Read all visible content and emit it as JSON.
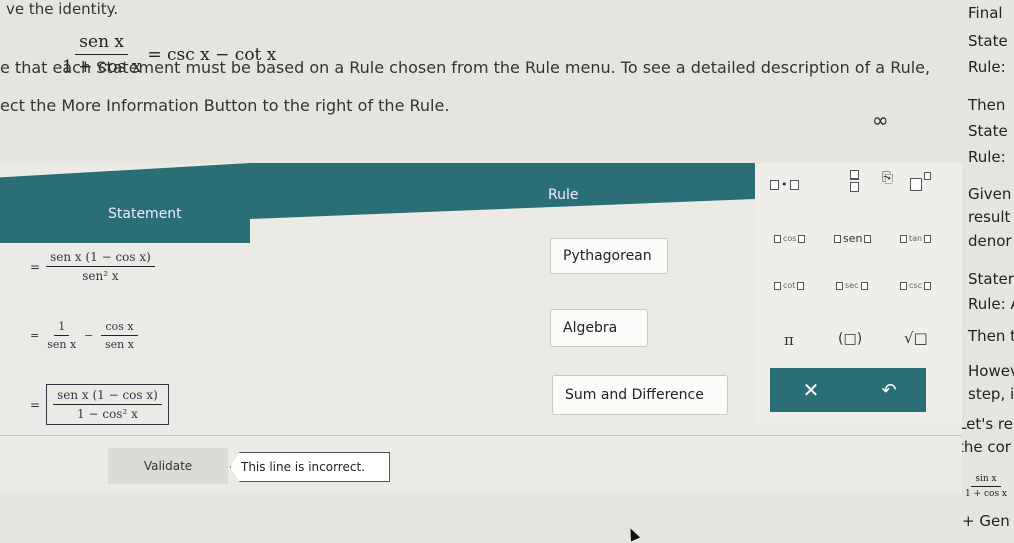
{
  "page": {
    "top_fragment": "ve the identity.",
    "identity": {
      "num": "sen x",
      "den": "1 + cos x",
      "rhs": "= csc x − cot x"
    },
    "instruction_line1": "e that each Statement must be based on a Rule chosen from the Rule menu. To see a detailed description of a Rule,",
    "instruction_line2": "ect the More Information Button to the right of the Rule.",
    "infinity": "∞"
  },
  "headers": {
    "statement": "Statement",
    "rule": "Rule"
  },
  "rows": [
    {
      "stmt_num": "sen x (1 − cos x)",
      "stmt_den": "sen² x",
      "rule": "Pythagorean"
    },
    {
      "stmt_a": "1",
      "stmt_a_den": "sen x",
      "stmt_b": "cos x",
      "stmt_b_den": "sen x",
      "rule": "Algebra"
    },
    {
      "stmt_num": "sen x (1 − cos x)",
      "stmt_den": "1 − cos² x",
      "rule": "Sum and Difference"
    }
  ],
  "validate": {
    "label": "Validate",
    "message": "This line is incorrect."
  },
  "keypad": {
    "dot": "•",
    "frac": "frac",
    "sup": "sup",
    "cos": "cos",
    "sen": "sen",
    "tan": "tan",
    "cot": "cot",
    "sec": "sec",
    "csc": "csc",
    "pi": "π",
    "paren": "(□)",
    "sqrt": "√□",
    "times": "✕",
    "undo": "↶"
  },
  "right_column": {
    "l1": "Final",
    "l2": "State",
    "l3": "Rule:",
    "l4": "Then",
    "l5": "State",
    "l6": "Rule:",
    "l7": "Given",
    "l8": "result",
    "l9": "denor",
    "l10": "Stater",
    "l11": "Rule: A",
    "l12": "Then t",
    "l13": "Howev",
    "l14": "step, it",
    "l15": "Let's re",
    "l16": "the cor",
    "l17_num": "sin x",
    "l17_den": "1 + cos x",
    "l18": "+ Gen"
  },
  "colors": {
    "accent": "#2a6f76"
  }
}
